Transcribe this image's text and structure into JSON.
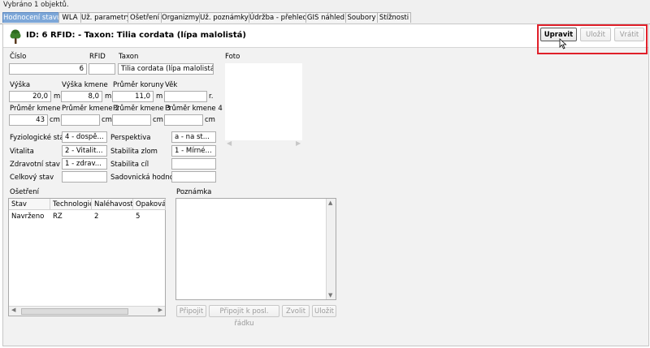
{
  "status": {
    "selection_text": "Vybráno 1 objektů."
  },
  "tabs": [
    {
      "label": "Hodnocení stavu",
      "active": true
    },
    {
      "label": "WLA"
    },
    {
      "label": "Už. parametry"
    },
    {
      "label": "Ošetření"
    },
    {
      "label": "Organizmy"
    },
    {
      "label": "Už. poznámky"
    },
    {
      "label": "Údržba - přehled"
    },
    {
      "label": "GIS náhled"
    },
    {
      "label": "Soubory"
    },
    {
      "label": "Stížnosti"
    }
  ],
  "header": {
    "icon": "tree-icon",
    "title": "ID:  6  RFID:  -   Taxon:  Tilia cordata (lípa malolistá)",
    "buttons": {
      "edit": "Upravit",
      "save": "Uložit",
      "revert": "Vrátit"
    }
  },
  "form": {
    "cislo": {
      "label": "Číslo",
      "value": "6"
    },
    "rfid": {
      "label": "RFID",
      "value": ""
    },
    "taxon": {
      "label": "Taxon",
      "value": "Tilia cordata (lípa malolistá)"
    },
    "foto": {
      "label": "Foto"
    },
    "vyska": {
      "label": "Výška",
      "value": "20,0",
      "unit": "m"
    },
    "vyska_kmene": {
      "label": "Výška kmene",
      "value": "8,0",
      "unit": "m"
    },
    "prumer_koruny": {
      "label": "Průměr koruny",
      "value": "11,0",
      "unit": "m"
    },
    "vek": {
      "label": "Věk",
      "value": "",
      "unit": "r."
    },
    "prumer_kmene": {
      "label": "Průměr kmene",
      "value": "43",
      "unit": "cm"
    },
    "prumer_kmene2": {
      "label": "Průměr kmene 2",
      "value": "",
      "unit": "cm"
    },
    "prumer_kmene3": {
      "label": "Průměr kmene 3",
      "value": "",
      "unit": "cm"
    },
    "prumer_kmene4": {
      "label": "Průměr kmene 4",
      "value": "",
      "unit": "cm"
    },
    "fyziologicke_stari": {
      "label": "Fyziologické stáří",
      "value": "4 - dospě..."
    },
    "vitalita": {
      "label": "Vitalita",
      "value": "2 - Vitalit..."
    },
    "zdravotni_stav": {
      "label": "Zdravotní stav",
      "value": "1 - zdrav..."
    },
    "celkovy_stav": {
      "label": "Celkový stav",
      "value": ""
    },
    "perspektiva": {
      "label": "Perspektiva",
      "value": "a - na st..."
    },
    "stabilita_zlom": {
      "label": "Stabilita zlom",
      "value": "1 - Mírné..."
    },
    "stabilita_cil": {
      "label": "Stabilita cíl",
      "value": ""
    },
    "sadovnicka_hodnota": {
      "label": "Sadovnická hodnota",
      "value": ""
    }
  },
  "treatment": {
    "label": "Ošetření",
    "columns": [
      "Stav",
      "Technologie",
      "Naléhavost",
      "Opakován"
    ],
    "rows": [
      [
        "Navrženo",
        "RZ",
        "2",
        "5"
      ]
    ]
  },
  "note": {
    "label": "Poznámka",
    "buttons": {
      "attach": "Připojit",
      "attach_last": "Připojit k posl. řádku",
      "choose": "Zvolit",
      "save": "Uložit"
    }
  }
}
